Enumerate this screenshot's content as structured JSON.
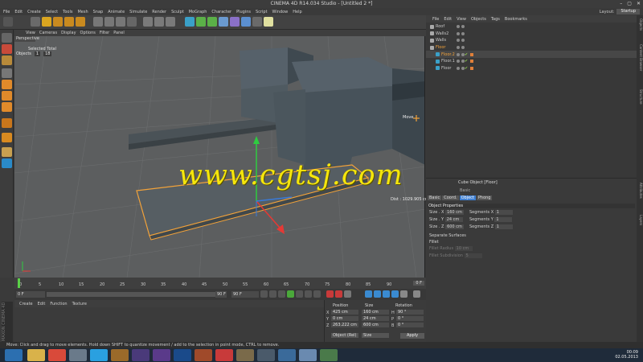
{
  "window": {
    "title": "CINEMA 4D R14.034 Studio - [Untitled 2 *]",
    "btn_min": "–",
    "btn_max": "▢",
    "btn_close": "✕"
  },
  "menubar": [
    "File",
    "Edit",
    "Create",
    "Select",
    "Tools",
    "Mesh",
    "Snap",
    "Animate",
    "Simulate",
    "Render",
    "Sculpt",
    "MoGraph",
    "Character",
    "Plugins",
    "Script",
    "Window",
    "Help"
  ],
  "layout": {
    "label": "Layout:",
    "value": "Startup"
  },
  "viewport": {
    "menu": [
      "View",
      "Cameras",
      "Display",
      "Options",
      "Filter",
      "Panel"
    ],
    "name": "Perspective",
    "stats_header": "Selected Total",
    "stats_label": "Objects",
    "stats_selected": "1",
    "stats_total": "18",
    "tool_label": "Move",
    "dist_label": "Dist : 1029.905 cm"
  },
  "timeline": {
    "ticks": [
      "0",
      "5",
      "10",
      "15",
      "20",
      "25",
      "30",
      "35",
      "40",
      "45",
      "50",
      "55",
      "60",
      "65",
      "70",
      "75",
      "80",
      "85",
      "90"
    ],
    "frame": "0 F",
    "start": "0 F",
    "end": "90 F",
    "preview_end": "90 F"
  },
  "material_manager": {
    "menu": [
      "Create",
      "Edit",
      "Function",
      "Texture"
    ]
  },
  "brand": "MAXON CINEMA 4D",
  "coordinates": {
    "headers": [
      "Position",
      "Size",
      "Rotation"
    ],
    "rows": [
      {
        "axis": "X",
        "pos": "425 cm",
        "size": "160 cm",
        "rot_label": "H",
        "rot": "90 °"
      },
      {
        "axis": "Y",
        "pos": "0 cm",
        "size": "24 cm",
        "rot_label": "P",
        "rot": "0 °"
      },
      {
        "axis": "Z",
        "pos": "263.222 cm",
        "size": "600 cm",
        "rot_label": "B",
        "rot": "0 °"
      }
    ],
    "mode_1": "Object (Rel)",
    "mode_2": "Size",
    "apply": "Apply"
  },
  "object_manager": {
    "menu": [
      "File",
      "Edit",
      "View",
      "Objects",
      "Tags",
      "Bookmarks"
    ],
    "objects": [
      {
        "name": "Roof",
        "selected": false
      },
      {
        "name": "Walls2",
        "selected": false
      },
      {
        "name": "Walls",
        "selected": false
      },
      {
        "name": "Floor",
        "selected": true
      },
      {
        "name": "Floor.2",
        "selected": true
      },
      {
        "name": "Floor.1",
        "selected": false
      },
      {
        "name": "Floor",
        "selected": false
      }
    ]
  },
  "attributes": {
    "title": "Cube Object [Floor]",
    "sub": "Basic",
    "tabs": [
      "Basic",
      "Coord.",
      "Object",
      "Phong"
    ],
    "active_tab": "Object",
    "section": "Object Properties",
    "size_x_label": "Size . X",
    "size_x": "160 cm",
    "size_y_label": "Size . Y",
    "size_y": "24 cm",
    "size_z_label": "Size . Z",
    "size_z": "600 cm",
    "seg_x_label": "Segments X",
    "seg_x": "1",
    "seg_y_label": "Segments Y",
    "seg_y": "1",
    "seg_z_label": "Segments Z",
    "seg_z": "1",
    "separate": "Separate Surfaces",
    "fillet": "Fillet",
    "fillet_radius_label": "Fillet Radius",
    "fillet_radius": "10 cm",
    "fillet_sub_label": "Fillet Subdivision",
    "fillet_sub": "5"
  },
  "right_strip": [
    "Objects",
    "Content Browser",
    "Structure",
    "Attributes",
    "Layers"
  ],
  "status": "Move: Click and drag to move elements. Hold down SHIFT to quantize movement / add to the selection in point mode, CTRL to remove.",
  "watermark": "www.cgtsj.com",
  "clock": {
    "time": "00:09",
    "date": "02.05.2013"
  },
  "colors": {
    "selection": "#f2a23a",
    "accent": "#3f7fd1",
    "watermark": "#f5e60c",
    "axis_y": "#2ecc40",
    "axis_x": "#e53935"
  }
}
